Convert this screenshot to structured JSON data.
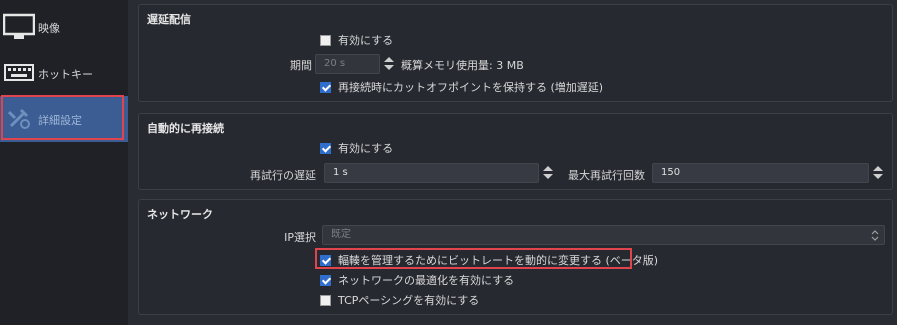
{
  "sidebar": {
    "items": [
      {
        "label": "映像",
        "icon": "monitor-icon"
      },
      {
        "label": "ホットキー",
        "icon": "keyboard-icon"
      },
      {
        "label": "詳細設定",
        "icon": "advanced-settings-icon",
        "active": true
      }
    ]
  },
  "groups": {
    "delay": {
      "title": "遅延配信",
      "enable_label": "有効にする",
      "enable_checked": false,
      "duration_label": "期間",
      "duration_value": "20 s",
      "memory_text": "概算メモリ使用量: 3 MB",
      "preserve_label": "再接続時にカットオフポイントを保持する (増加遅延)",
      "preserve_checked": true
    },
    "reconnect": {
      "title": "自動的に再接続",
      "enable_label": "有効にする",
      "enable_checked": true,
      "retry_delay_label": "再試行の遅延",
      "retry_delay_value": "1 s",
      "max_retries_label": "最大再試行回数",
      "max_retries_value": "150"
    },
    "network": {
      "title": "ネットワーク",
      "ip_label": "IP選択",
      "ip_value": "既定",
      "dynamic_bitrate_label": "輻輳を管理するためにビットレートを動的に変更する (ベータ版)",
      "dynamic_bitrate_checked": true,
      "optimize_label": "ネットワークの最適化を有効にする",
      "optimize_checked": true,
      "tcp_pacing_label": "TCPペーシングを有効にする",
      "tcp_pacing_checked": false
    }
  },
  "colors": {
    "accent": "#2f6ecc",
    "highlight": "#e0454d",
    "active_nav": "#3b5d94"
  }
}
